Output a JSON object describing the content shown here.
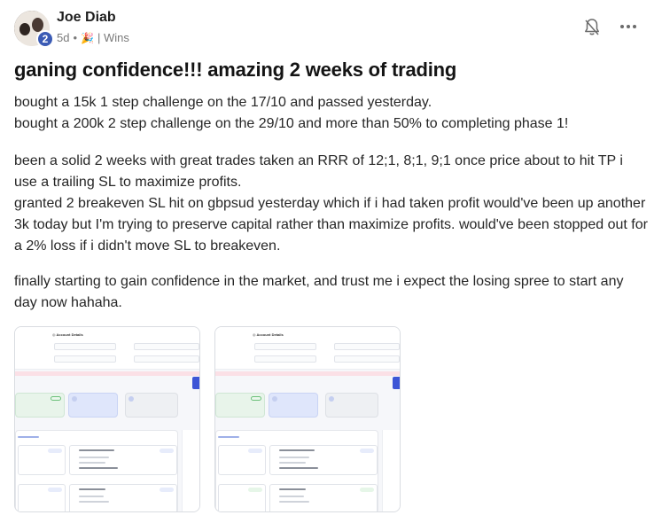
{
  "post": {
    "author": "Joe Diab",
    "level": "2",
    "age": "5d",
    "separator": "•",
    "category": "| Wins",
    "title": "ganing confidence!!! amazing 2 weeks of trading",
    "paragraphs": [
      "bought a 15k 1 step challenge on the 17/10 and passed yesterday.\nbought a 200k 2 step challenge on the 29/10 and more than 50% to completing phase 1!",
      "been a solid 2 weeks with great trades taken an RRR of 12;1, 8;1, 9;1 once price about to hit TP i use a trailing SL to maximize profits.\ngranted 2 breakeven SL hit on gbpsud yesterday which if i had taken profit would've been up another 3k today but I'm trying to preserve capital rather than maximize profits. would've been stopped out for a 2% loss if i didn't move SL to breakeven.",
      "finally starting to gain confidence in the market, and trust me i expect the losing spree to start any day now hahaha."
    ],
    "attachments": [
      "screenshot-1",
      "screenshot-2"
    ]
  },
  "icons": {
    "bell": "bell-off-icon",
    "more": "more-horizontal-icon",
    "category": "party-popper-icon"
  },
  "colors": {
    "badge": "#3b5bb5",
    "text": "#262626",
    "meta": "#7a7a7a"
  }
}
